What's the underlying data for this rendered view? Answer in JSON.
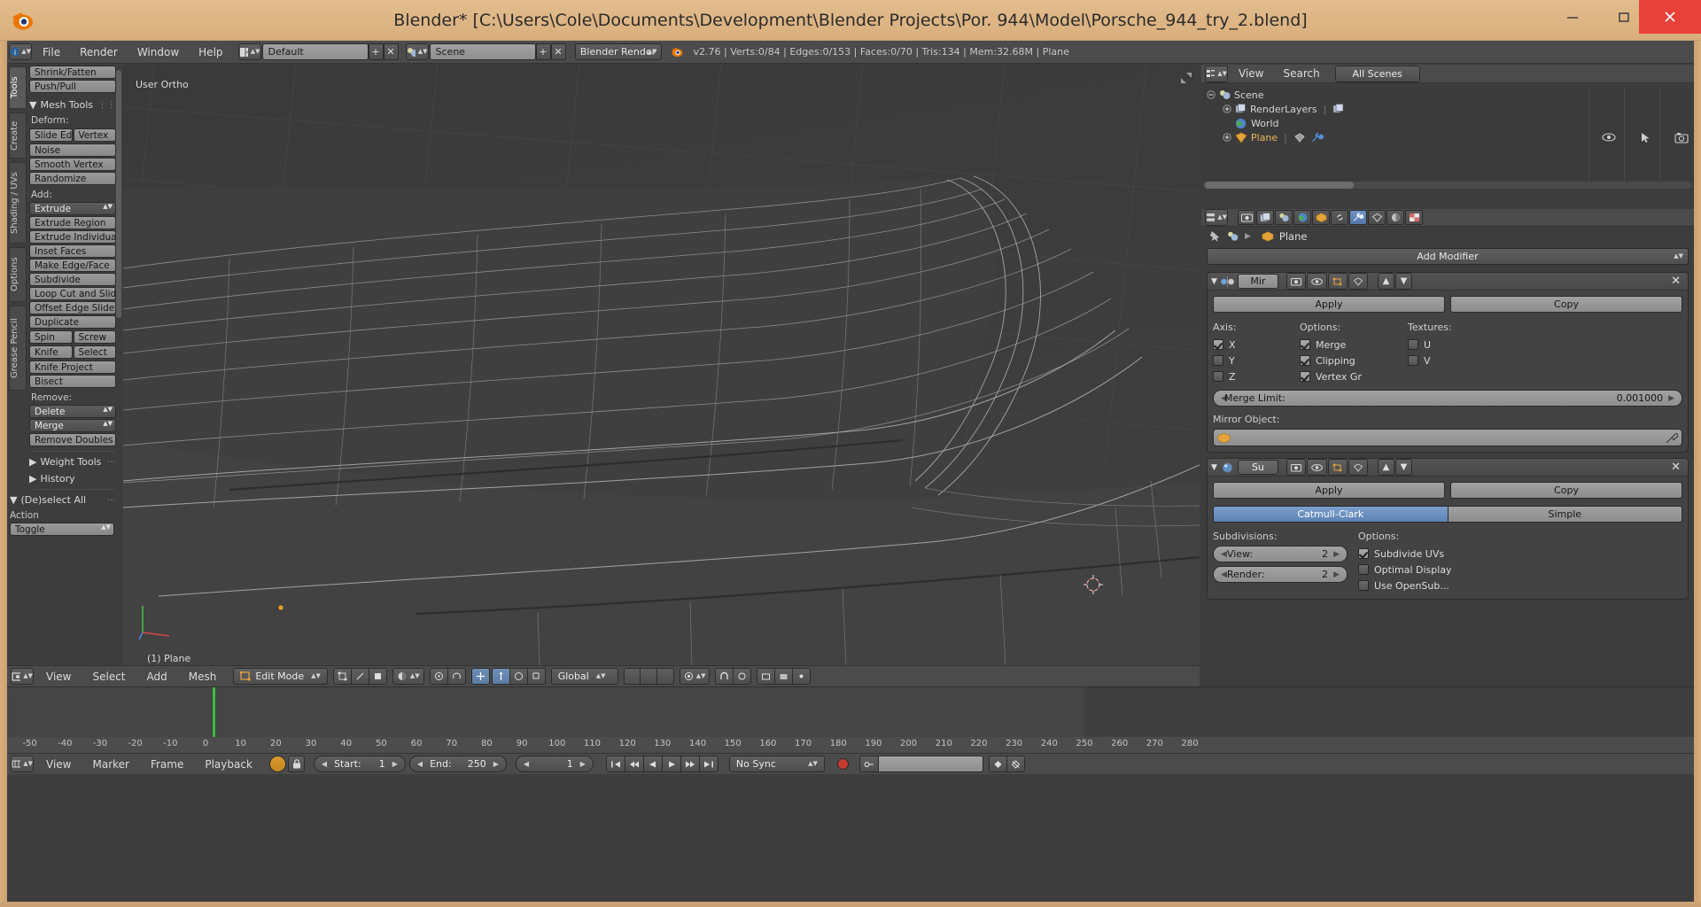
{
  "window": {
    "title": "Blender* [C:\\Users\\Cole\\Documents\\Development\\Blender Projects\\Por. 944\\Model\\Porsche_944_try_2.blend]",
    "minimize": "—",
    "maximize": "▭",
    "close": "✕"
  },
  "topbar": {
    "menus": [
      "File",
      "Render",
      "Window",
      "Help"
    ],
    "screen_layout": "Default",
    "scene": "Scene",
    "engine": "Blender Render",
    "stats": "v2.76 | Verts:0/84 | Edges:0/153 | Faces:0/70 | Tris:134 | Mem:32.68M | Plane",
    "add_icon": "+",
    "remove_icon": "✕"
  },
  "toolshelf": {
    "tabs": [
      "Tools",
      "Create",
      "Shading / UVs",
      "Options",
      "Grease Pencil"
    ],
    "active_tab": "Tools",
    "top_buttons": [
      "Shrink/Fatten",
      "Push/Pull"
    ],
    "mesh_tools_panel": "Mesh Tools",
    "deform_label": "Deform:",
    "deform_pair": [
      "Slide Ed",
      "Vertex"
    ],
    "deform_buttons": [
      "Noise",
      "Smooth Vertex",
      "Randomize"
    ],
    "add_label": "Add:",
    "add_dropdown": "Extrude",
    "add_buttons": [
      "Extrude Region",
      "Extrude Individual",
      "Inset Faces",
      "Make Edge/Face",
      "Subdivide",
      "Loop Cut and Slide",
      "Offset Edge Slide",
      "Duplicate"
    ],
    "add_pair_1": [
      "Spin",
      "Screw"
    ],
    "add_pair_2": [
      "Knife",
      "Select"
    ],
    "add_buttons_2": [
      "Knife Project",
      "Bisect"
    ],
    "remove_label": "Remove:",
    "remove_dropdowns": [
      "Delete",
      "Merge"
    ],
    "remove_buttons": [
      "Remove Doubles"
    ],
    "collapsed_panels": [
      "Weight Tools",
      "History"
    ],
    "deselect_panel": "(De)select All",
    "action_label": "Action",
    "action_value": "Toggle"
  },
  "viewport": {
    "view_label": "User Ortho",
    "object_label": "(1) Plane",
    "gizmo_axes": [
      "X",
      "Y",
      "Z"
    ]
  },
  "viewport_footer": {
    "menus": [
      "View",
      "Select",
      "Add",
      "Mesh"
    ],
    "mode": "Edit Mode",
    "orientation": "Global",
    "pivot_icon": "pivot-icon",
    "snap_icon": "magnet-icon",
    "proportional_icon": "proportional-edit-icon"
  },
  "outliner": {
    "header_menus": [
      "View",
      "Search"
    ],
    "display_mode": "All Scenes",
    "rows": [
      {
        "label": "Scene",
        "icon": "scene-icon",
        "indent": 0,
        "expander": "minus"
      },
      {
        "label": "RenderLayers",
        "icon": "renderlayers-icon",
        "indent": 1,
        "expander": "plus"
      },
      {
        "label": "World",
        "icon": "world-icon",
        "indent": 1,
        "expander": "none"
      },
      {
        "label": "Plane",
        "icon": "mesh-object-icon",
        "indent": 1,
        "expander": "plus"
      }
    ]
  },
  "properties": {
    "tabs": [
      "render-tab",
      "render-layers-tab",
      "scene-tab",
      "world-tab",
      "object-tab",
      "constraints-tab",
      "modifiers-tab",
      "data-tab",
      "material-tab",
      "texture-tab"
    ],
    "active_tab": "modifiers-tab",
    "breadcrumb_scene": "Scene",
    "breadcrumb_object": "Plane",
    "add_modifier": "Add Modifier",
    "modifiers": [
      {
        "name": "Mir",
        "type": "mirror",
        "apply": "Apply",
        "copy": "Copy",
        "col_headers": [
          "Axis:",
          "Options:",
          "Textures:"
        ],
        "axis": [
          {
            "label": "X",
            "checked": true
          },
          {
            "label": "Y",
            "checked": false
          },
          {
            "label": "Z",
            "checked": false
          }
        ],
        "options": [
          {
            "label": "Merge",
            "checked": true
          },
          {
            "label": "Clipping",
            "checked": true
          },
          {
            "label": "Vertex Gr",
            "checked": true
          }
        ],
        "textures": [
          {
            "label": "U",
            "checked": false
          },
          {
            "label": "V",
            "checked": false
          }
        ],
        "merge_limit_label": "Merge Limit:",
        "merge_limit_value": "0.001000",
        "mirror_object_label": "Mirror Object:",
        "mirror_object_value": ""
      },
      {
        "name": "Su",
        "type": "subsurf",
        "apply": "Apply",
        "copy": "Copy",
        "algo": [
          "Catmull-Clark",
          "Simple"
        ],
        "algo_selected": "Catmull-Clark",
        "subdivisions_label": "Subdivisions:",
        "options_label": "Options:",
        "view_label": "View:",
        "view_value": "2",
        "render_label": "Render:",
        "render_value": "2",
        "options": [
          {
            "label": "Subdivide UVs",
            "checked": true
          },
          {
            "label": "Optimal Display",
            "checked": false
          },
          {
            "label": "Use OpenSub...",
            "checked": false
          }
        ]
      }
    ]
  },
  "timeline": {
    "menus": [
      "View",
      "Marker",
      "Frame",
      "Playback"
    ],
    "start_label": "Start:",
    "start_value": "1",
    "end_label": "End:",
    "end_value": "250",
    "current_frame": "1",
    "sync_mode": "No Sync",
    "ticks": [
      "-50",
      "-40",
      "-30",
      "-20",
      "-10",
      "0",
      "10",
      "20",
      "30",
      "40",
      "50",
      "60",
      "70",
      "80",
      "90",
      "100",
      "110",
      "120",
      "130",
      "140",
      "150",
      "160",
      "170",
      "180",
      "190",
      "200",
      "210",
      "220",
      "230",
      "240",
      "250",
      "260",
      "270",
      "280"
    ],
    "playhead_frame": "1"
  },
  "colors": {
    "titlebar": "#dcb082",
    "close_button": "#e8413a",
    "accent_blue": "#5d82b4",
    "playhead_green": "#3dbd3d",
    "record_red": "#c43c30",
    "blender_orange": "#ea7600"
  }
}
